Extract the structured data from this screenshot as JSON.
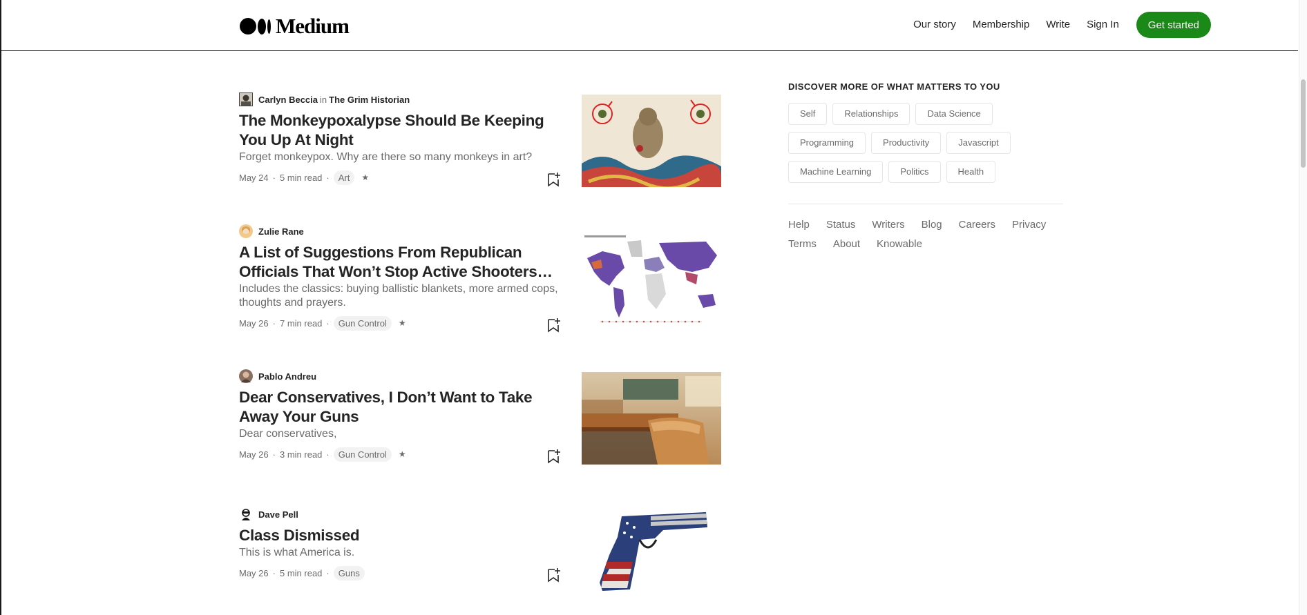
{
  "header": {
    "logo_text": "Medium",
    "nav": [
      "Our story",
      "Membership",
      "Write",
      "Sign In"
    ],
    "cta": "Get started"
  },
  "articles": [
    {
      "author": "Carlyn Beccia",
      "in_label": "in",
      "publication": "The Grim Historian",
      "title": "The Monkeypoxalypse Should Be Keeping You Up At Night",
      "subtitle": "Forget monkeypox. Why are there so many monkeys in art?",
      "date": "May 24",
      "read_time": "5 min read",
      "tag": "Art",
      "member_only": true,
      "image": "monkey-manuscript-illustration"
    },
    {
      "author": "Zulie Rane",
      "title": "A List of Suggestions From Republican Officials That Won’t Stop Active Shooters Fro…",
      "subtitle": "Includes the classics: buying ballistic blankets, more armed cops, thoughts and prayers.",
      "date": "May 26",
      "read_time": "7 min read",
      "tag": "Gun Control",
      "member_only": true,
      "image": "world-map-chart"
    },
    {
      "author": "Pablo Andreu",
      "title": "Dear Conservatives, I Don’t Want to Take Away Your Guns",
      "subtitle": "Dear conservatives,",
      "date": "May 26",
      "read_time": "3 min read",
      "tag": "Gun Control",
      "member_only": true,
      "image": "empty-classroom-desk"
    },
    {
      "author": "Dave Pell",
      "title": "Class Dismissed",
      "subtitle": "This is what America is.",
      "date": "May 26",
      "read_time": "5 min read",
      "tag": "Guns",
      "member_only": false,
      "image": "american-flag-pistol"
    }
  ],
  "sidebar": {
    "heading": "DISCOVER MORE OF WHAT MATTERS TO YOU",
    "topics": [
      "Self",
      "Relationships",
      "Data Science",
      "Programming",
      "Productivity",
      "Javascript",
      "Machine Learning",
      "Politics",
      "Health"
    ],
    "footer_links": [
      "Help",
      "Status",
      "Writers",
      "Blog",
      "Careers",
      "Privacy",
      "Terms",
      "About",
      "Knowable"
    ]
  },
  "colors": {
    "accent": "#1a8917",
    "text": "#242424",
    "muted": "#6b6b6b",
    "tag_bg": "#f2f2f2"
  },
  "icons": {
    "bookmark": "bookmark-add-icon",
    "member": "star-icon"
  }
}
